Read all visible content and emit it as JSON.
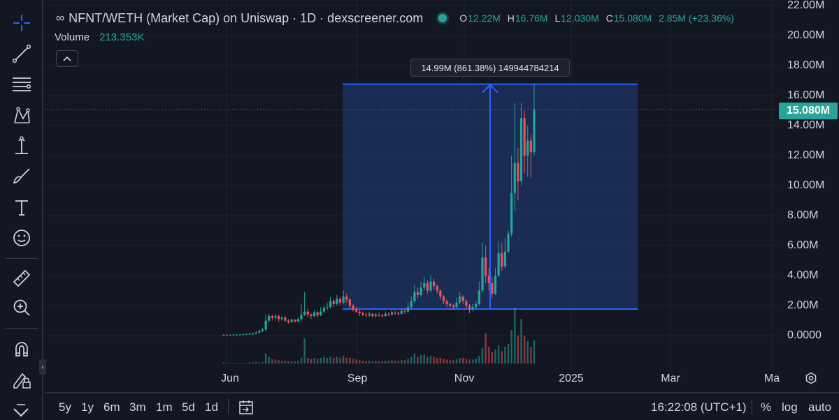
{
  "legend": {
    "symbol": "∞",
    "title": "NFNT/WETH (Market Cap) on Uniswap · 1D · dexscreener.com",
    "open_key": "O",
    "open": "12.22M",
    "high_key": "H",
    "high": "16.76M",
    "low_key": "L",
    "low": "12.030M",
    "close_key": "C",
    "close": "15.080M",
    "change": "2.85M (+23.36%)",
    "volume_label": "Volume",
    "volume_value": "213.353K",
    "collapse_icon": "chevron-up-icon"
  },
  "measure_tooltip": "14.99M (861.38%) 149944784214",
  "current_price": "15.080M",
  "price_axis": [
    "22.00M",
    "20.00M",
    "18.00M",
    "16.00M",
    "14.00M",
    "12.00M",
    "10.00M",
    "8.00M",
    "6.00M",
    "4.00M",
    "2.00M",
    "0.0000"
  ],
  "time_axis": [
    "Jun",
    "Sep",
    "Nov",
    "2025",
    "Mar",
    "Ma"
  ],
  "bottom_bar": {
    "ranges": [
      "5y",
      "1y",
      "6m",
      "3m",
      "1m",
      "5d",
      "1d"
    ],
    "clock": "16:22:08 (UTC+1)",
    "percent": "%",
    "log": "log",
    "auto": "auto"
  },
  "tools": [
    "crosshair-icon",
    "trend-line-icon",
    "fib-retracement-icon",
    "pattern-icon",
    "measure-icon",
    "brush-icon",
    "text-icon",
    "emoji-icon",
    "ruler-icon",
    "zoom-in-icon",
    "magnet-icon",
    "lock-drawing-icon",
    "trash-icon"
  ],
  "colors": {
    "background": "#131722",
    "up": "#26a69a",
    "down": "#ef5350",
    "range_fill": "#1e3365",
    "range_line": "#2962ff"
  },
  "chart_data": {
    "type": "candlestick",
    "y_unit": "market cap (USD)",
    "ylim": [
      -1.2,
      22
    ],
    "x_ticks": [
      "Jun",
      "Sep",
      "Nov",
      "2025",
      "Mar",
      "Ma"
    ],
    "price_range_measure": {
      "from": 1.77,
      "to": 16.76,
      "change": "14.99M (861.38%) 149944784214"
    },
    "current": 15.08,
    "candles": [
      [
        0.0,
        0.05,
        0.0,
        0.1
      ],
      [
        0.05,
        0.04,
        0.0,
        0.1
      ],
      [
        0.04,
        0.05,
        0.0,
        0.1
      ],
      [
        0.05,
        0.06,
        0.0,
        0.1
      ],
      [
        0.06,
        0.06,
        0.0,
        0.1
      ],
      [
        0.06,
        0.07,
        0.0,
        0.1
      ],
      [
        0.07,
        0.08,
        0.0,
        0.12
      ],
      [
        0.08,
        0.1,
        0.05,
        0.15
      ],
      [
        0.1,
        0.12,
        0.05,
        0.2
      ],
      [
        0.12,
        0.12,
        0.05,
        0.2
      ],
      [
        0.12,
        0.2,
        0.1,
        0.3
      ],
      [
        0.2,
        0.3,
        0.15,
        0.4
      ],
      [
        0.3,
        0.4,
        0.25,
        0.5
      ],
      [
        0.4,
        1.0,
        0.3,
        1.4
      ],
      [
        1.0,
        1.3,
        0.9,
        1.45
      ],
      [
        1.3,
        1.2,
        1.0,
        1.4
      ],
      [
        1.2,
        1.3,
        1.0,
        1.45
      ],
      [
        1.3,
        1.1,
        0.9,
        1.4
      ],
      [
        1.1,
        1.2,
        1.0,
        1.3
      ],
      [
        1.2,
        1.0,
        0.9,
        1.3
      ],
      [
        1.0,
        0.9,
        0.8,
        1.1
      ],
      [
        0.9,
        1.05,
        0.85,
        1.15
      ],
      [
        1.05,
        0.95,
        0.85,
        1.1
      ],
      [
        0.95,
        1.1,
        0.9,
        1.2
      ],
      [
        1.1,
        1.4,
        1.0,
        2.1
      ],
      [
        1.4,
        1.6,
        1.3,
        2.9
      ],
      [
        1.6,
        1.4,
        1.2,
        1.8
      ],
      [
        1.4,
        1.3,
        1.1,
        1.5
      ],
      [
        1.3,
        1.55,
        1.2,
        1.7
      ],
      [
        1.55,
        1.35,
        1.2,
        1.6
      ],
      [
        1.35,
        1.6,
        1.3,
        1.9
      ],
      [
        1.6,
        1.85,
        1.5,
        2.0
      ],
      [
        1.85,
        1.9,
        1.7,
        2.2
      ],
      [
        1.9,
        2.3,
        1.8,
        2.6
      ],
      [
        2.3,
        2.1,
        1.9,
        2.4
      ],
      [
        2.1,
        2.45,
        2.0,
        2.7
      ],
      [
        2.45,
        2.2,
        2.0,
        2.6
      ],
      [
        2.2,
        2.6,
        2.1,
        3.0
      ],
      [
        2.6,
        2.4,
        2.2,
        2.8
      ],
      [
        2.4,
        2.0,
        1.8,
        2.5
      ],
      [
        2.0,
        1.75,
        1.6,
        2.1
      ],
      [
        1.75,
        1.6,
        1.5,
        1.9
      ],
      [
        1.6,
        1.5,
        1.3,
        1.7
      ],
      [
        1.5,
        1.4,
        1.3,
        1.6
      ],
      [
        1.4,
        1.35,
        1.2,
        1.55
      ],
      [
        1.35,
        1.45,
        1.25,
        1.6
      ],
      [
        1.45,
        1.3,
        1.2,
        1.5
      ],
      [
        1.3,
        1.4,
        1.2,
        1.5
      ],
      [
        1.4,
        1.35,
        1.25,
        1.55
      ],
      [
        1.35,
        1.3,
        1.2,
        1.45
      ],
      [
        1.3,
        1.45,
        1.25,
        1.6
      ],
      [
        1.45,
        1.4,
        1.3,
        1.55
      ],
      [
        1.4,
        1.55,
        1.35,
        1.7
      ],
      [
        1.55,
        1.5,
        1.35,
        1.65
      ],
      [
        1.5,
        1.45,
        1.3,
        1.6
      ],
      [
        1.45,
        1.65,
        1.4,
        1.8
      ],
      [
        1.65,
        1.6,
        1.45,
        1.8
      ],
      [
        1.6,
        1.9,
        1.5,
        2.2
      ],
      [
        1.9,
        2.3,
        1.8,
        2.6
      ],
      [
        2.3,
        2.9,
        2.2,
        3.4
      ],
      [
        2.9,
        2.7,
        2.5,
        3.2
      ],
      [
        2.7,
        3.2,
        2.6,
        3.6
      ],
      [
        3.2,
        3.5,
        3.0,
        3.9
      ],
      [
        3.5,
        3.0,
        2.8,
        3.7
      ],
      [
        3.0,
        3.6,
        2.9,
        4.0
      ],
      [
        3.6,
        3.3,
        3.1,
        3.8
      ],
      [
        3.3,
        3.0,
        2.8,
        3.4
      ],
      [
        3.0,
        2.6,
        2.4,
        3.1
      ],
      [
        2.6,
        2.3,
        2.1,
        2.7
      ],
      [
        2.3,
        2.1,
        1.9,
        2.4
      ],
      [
        2.1,
        2.0,
        1.8,
        2.2
      ],
      [
        2.0,
        1.9,
        1.7,
        2.1
      ],
      [
        1.9,
        2.2,
        1.8,
        2.5
      ],
      [
        2.2,
        2.6,
        2.1,
        2.9
      ],
      [
        2.6,
        2.3,
        2.1,
        2.7
      ],
      [
        2.3,
        2.0,
        1.8,
        2.4
      ],
      [
        2.0,
        1.8,
        1.5,
        2.1
      ],
      [
        1.8,
        1.9,
        1.6,
        2.1
      ],
      [
        1.9,
        2.1,
        1.8,
        2.3
      ],
      [
        2.1,
        3.0,
        2.0,
        3.6
      ],
      [
        3.0,
        5.2,
        2.9,
        6.2
      ],
      [
        5.2,
        4.0,
        3.5,
        6.0
      ],
      [
        4.0,
        3.5,
        3.0,
        4.5
      ],
      [
        3.5,
        2.8,
        2.5,
        3.9
      ],
      [
        2.8,
        4.0,
        2.7,
        4.5
      ],
      [
        4.0,
        5.5,
        3.9,
        6.3
      ],
      [
        5.5,
        4.6,
        4.3,
        6.2
      ],
      [
        4.6,
        5.6,
        4.5,
        6.5
      ],
      [
        5.6,
        6.8,
        5.5,
        7.0
      ],
      [
        6.8,
        9.5,
        6.6,
        12.0
      ],
      [
        9.5,
        11.5,
        8.3,
        15.5
      ],
      [
        11.5,
        10.3,
        9.0,
        12.5
      ],
      [
        10.3,
        14.5,
        10.0,
        15.5
      ],
      [
        14.5,
        12.0,
        10.8,
        15.0
      ],
      [
        12.0,
        13.0,
        10.6,
        14.0
      ],
      [
        13.0,
        12.22,
        10.5,
        13.4
      ],
      [
        12.22,
        15.08,
        12.03,
        16.76
      ]
    ],
    "volume": [
      0.02,
      0.01,
      0.01,
      0.01,
      0.01,
      0.01,
      0.01,
      0.01,
      0.02,
      0.02,
      0.03,
      0.02,
      0.03,
      0.18,
      0.12,
      0.08,
      0.07,
      0.06,
      0.05,
      0.05,
      0.04,
      0.04,
      0.04,
      0.05,
      0.1,
      0.45,
      0.1,
      0.08,
      0.1,
      0.08,
      0.1,
      0.12,
      0.1,
      0.12,
      0.1,
      0.12,
      0.1,
      0.14,
      0.1,
      0.1,
      0.08,
      0.07,
      0.06,
      0.05,
      0.04,
      0.05,
      0.04,
      0.05,
      0.04,
      0.04,
      0.05,
      0.05,
      0.06,
      0.05,
      0.05,
      0.06,
      0.06,
      0.08,
      0.12,
      0.18,
      0.12,
      0.15,
      0.16,
      0.12,
      0.14,
      0.12,
      0.1,
      0.1,
      0.08,
      0.07,
      0.06,
      0.06,
      0.08,
      0.1,
      0.1,
      0.08,
      0.07,
      0.07,
      0.09,
      0.14,
      0.28,
      0.55,
      0.3,
      0.2,
      0.25,
      0.32,
      0.22,
      0.3,
      0.35,
      0.6,
      1.0,
      0.5,
      0.8,
      0.5,
      0.4,
      0.3,
      0.42
    ]
  }
}
